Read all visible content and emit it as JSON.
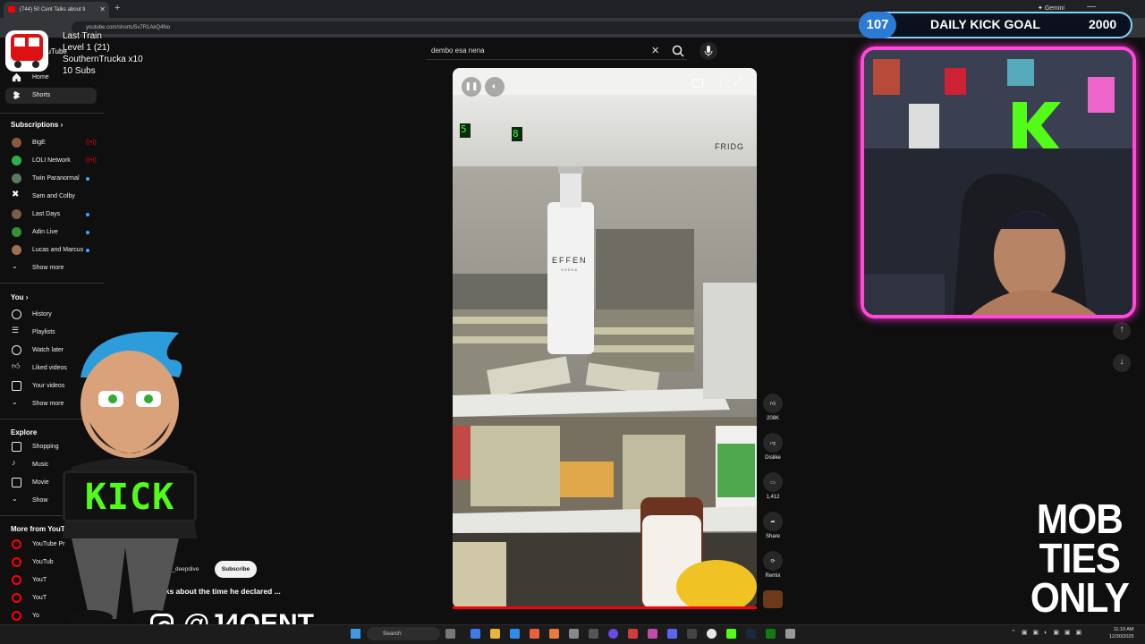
{
  "browser": {
    "tab_title": "(744) 50 Cent Talks about ti",
    "url": "youtube.com/shorts/5v7R1AkQ4No",
    "gemini_label": "Gemini",
    "new_tab": "+"
  },
  "stream_alert": {
    "line1": "Last Train",
    "line2": "Level 1  (21)",
    "line3": "SouthernTrucka x10",
    "line4": "10 Subs"
  },
  "sidebar": {
    "logo_partial": "ouTube",
    "top_items": [
      {
        "label": "Home"
      },
      {
        "label": "Shorts"
      }
    ],
    "subscriptions_header": "Subscriptions",
    "subscriptions": [
      {
        "label": "BigE",
        "color": "#8a5a3c",
        "live": true
      },
      {
        "label": "LOLI Network",
        "color": "#2bb24c",
        "live": true
      },
      {
        "label": "Twin Paranormal",
        "color": "#5c7a5c",
        "dot": true
      },
      {
        "label": "Sam and Colby",
        "color": "#ffffff",
        "dot": false
      },
      {
        "label": "Last Days",
        "color": "#7a5c4a",
        "dot": true
      },
      {
        "label": "Adin Live",
        "color": "#3b8f3b",
        "dot": true
      },
      {
        "label": "Lucas and Marcus",
        "color": "#a0704f",
        "dot": true
      }
    ],
    "show_more": "Show more",
    "you_header": "You",
    "you_items": [
      {
        "label": "History"
      },
      {
        "label": "Playlists"
      },
      {
        "label": "Watch later"
      },
      {
        "label": "Liked videos"
      },
      {
        "label": "Your videos"
      },
      {
        "label": "Show more"
      }
    ],
    "explore_header": "Explore",
    "explore_items": [
      {
        "label": "Shopping"
      },
      {
        "label": "Music"
      },
      {
        "label": "Movie"
      },
      {
        "label": "Show"
      }
    ],
    "more_header": "More from YouTub",
    "more_items": [
      {
        "label": "YouTube Pr"
      },
      {
        "label": "YouTub"
      },
      {
        "label": "YouT"
      },
      {
        "label": "YouT"
      },
      {
        "label": "Yo"
      }
    ]
  },
  "search": {
    "query": "dembo esa nena"
  },
  "video": {
    "overlay_brand": "FRIDG",
    "temp_left": "5",
    "temp_right": "8",
    "bottle_label": "EFFEN",
    "bottle_sub": "VODKA"
  },
  "channel": {
    "name": "raveled_deepdive",
    "subscribe_label": "Subscribe",
    "title": "k Talks about the time he declared ..."
  },
  "actions": {
    "like_count": "208K",
    "dislike_label": "Dislike",
    "comment_count": "1,412",
    "share_label": "Share",
    "remix_label": "Remix"
  },
  "kick_goal": {
    "current": "107",
    "label": "DAILY KICK GOAL",
    "target": "2000"
  },
  "kick_badge": "KICK",
  "social_handle": "@J4OENT",
  "mob_ties": [
    "MOB",
    "TIES",
    "ONLY"
  ],
  "taskbar": {
    "search_label": "Search",
    "time": "11:10 AM",
    "date": "12/30/2025"
  },
  "colors": {
    "kick_green": "#53fc18",
    "frame_pink": "#ff49d8",
    "yt_red": "#ff0000"
  }
}
